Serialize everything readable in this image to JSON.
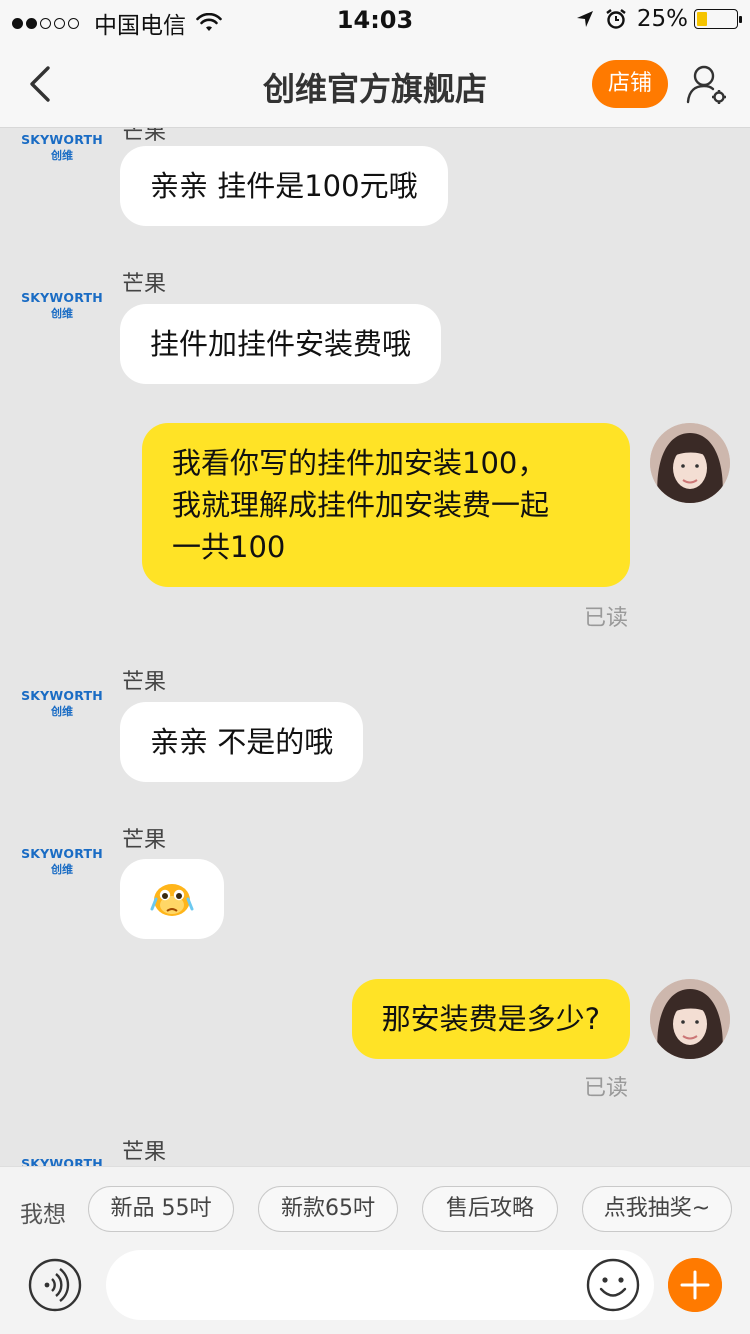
{
  "status_bar": {
    "carrier": "中国电信",
    "time": "14:03",
    "battery": "25%",
    "battery_level": 0.25,
    "signal_dots_filled": 2,
    "signal_dots_total": 5,
    "icons": [
      "wifi-icon",
      "location-arrow-icon",
      "alarm-icon",
      "battery-icon"
    ]
  },
  "nav": {
    "title": "创维官方旗舰店",
    "shop_label": "店铺",
    "back_icon": "chevron-left-icon",
    "profile_icon": "user-settings-icon"
  },
  "brand": {
    "name": "SKYWORTH",
    "name_cn": "创维"
  },
  "messages": [
    {
      "side": "left",
      "sender": "芒果",
      "text": "亲亲 挂件是100元哦"
    },
    {
      "side": "left",
      "sender": "芒果",
      "text": "挂件加挂件安装费哦"
    },
    {
      "side": "right",
      "lines": [
        "我看你写的挂件加安装100，",
        "我就理解成挂件加安装费一起",
        "一共100"
      ],
      "status": "已读"
    },
    {
      "side": "left",
      "sender": "芒果",
      "text": "亲亲 不是的哦"
    },
    {
      "side": "left",
      "sender": "芒果",
      "emoji": "crying-face-emoji"
    },
    {
      "side": "right",
      "text": "那安装费是多少?",
      "status": "已读"
    },
    {
      "side": "left",
      "sender": "芒果"
    }
  ],
  "quick_replies": {
    "label": "我想",
    "chips": [
      "新品 55吋",
      "新款65吋",
      "售后攻略",
      "点我抽奖~"
    ]
  },
  "input": {
    "value": "",
    "placeholder": "",
    "icons": [
      "voice-icon",
      "emoji-icon",
      "plus-icon"
    ]
  },
  "colors": {
    "accent": "#ff7a00",
    "my_bubble": "#ffe326",
    "their_bubble": "#ffffff",
    "background": "#e6e6e6",
    "brand_blue": "#1a6cc4"
  }
}
